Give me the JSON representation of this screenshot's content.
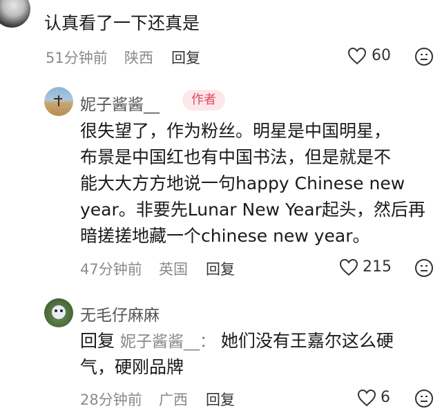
{
  "comments": [
    {
      "text": "认真看了一下还真是",
      "time": "51分钟前",
      "location": "陕西",
      "reply_label": "回复",
      "likes": "60"
    },
    {
      "username": "妮子酱酱__",
      "badge": "作者",
      "lines": [
        "很失望了，作为粉丝。明星是中国明星，",
        "布景是中国红也有中国书法，但是就是不",
        "能大大方方地说一句happy Chinese new",
        "year。非要先Lunar New Year起头，然后再",
        "暗搓搓地藏一个chinese new year。"
      ],
      "time": "47分钟前",
      "location": "英国",
      "reply_label": "回复",
      "likes": "215"
    },
    {
      "username": "无毛仔麻麻",
      "reply_prefix": "回复",
      "reply_target": "妮子酱酱__：",
      "line1_rest": "她们没有王嘉尔这么硬",
      "line2": "气，硬刚品牌",
      "time": "28分钟前",
      "location": "广西",
      "reply_label": "回复",
      "likes": "6"
    }
  ],
  "icons": {
    "like": "heart-outline-icon",
    "more": "smiley-face-icon"
  },
  "colors": {
    "badge_bg": "#fde7ea",
    "badge_text": "#e04860",
    "meta_text": "#8a8a8a"
  }
}
